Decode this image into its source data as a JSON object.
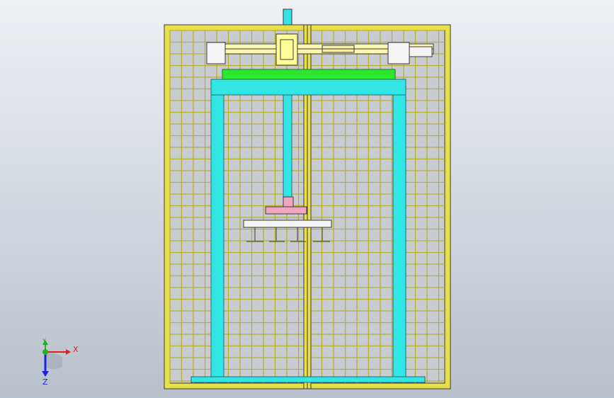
{
  "viewport": {
    "background_top": "#eef0f4",
    "background_bottom": "#b8c0cb"
  },
  "model": {
    "frame_color": "#e8e048",
    "grid_color": "#b5b030",
    "guard_color": "#ffff66",
    "column_color": "#33e6e6",
    "beam_color": "#2ee62e",
    "gripper_color": "#f2a6c2",
    "outline_color": "#3a3a3a"
  },
  "triad": {
    "x_label": "X",
    "y_label": "Y",
    "z_label": "Z",
    "x_color": "#e02020",
    "y_color": "#20b020",
    "z_color": "#2020e0"
  }
}
